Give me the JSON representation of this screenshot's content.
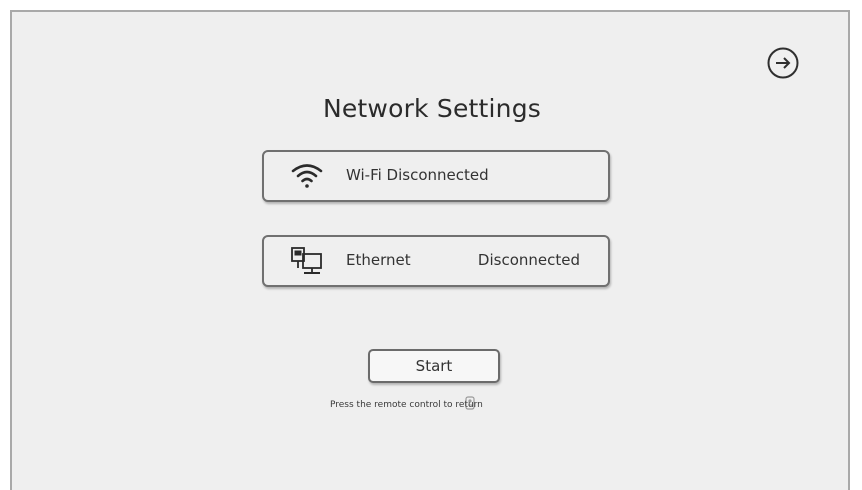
{
  "page": {
    "title": "Network Settings"
  },
  "header": {
    "next_icon": "arrow-right-circle-icon"
  },
  "wifi": {
    "icon": "wifi-icon",
    "label": "Wi-Fi Disconnected"
  },
  "ethernet": {
    "icon": "ethernet-monitor-icon",
    "label": "Ethernet",
    "status": "Disconnected"
  },
  "actions": {
    "start_label": "Start"
  },
  "hint": {
    "text": "Press the remote control to return",
    "icon": "remote-return-icon"
  },
  "colors": {
    "background": "#efefef",
    "border": "#707070",
    "text": "#333333"
  }
}
